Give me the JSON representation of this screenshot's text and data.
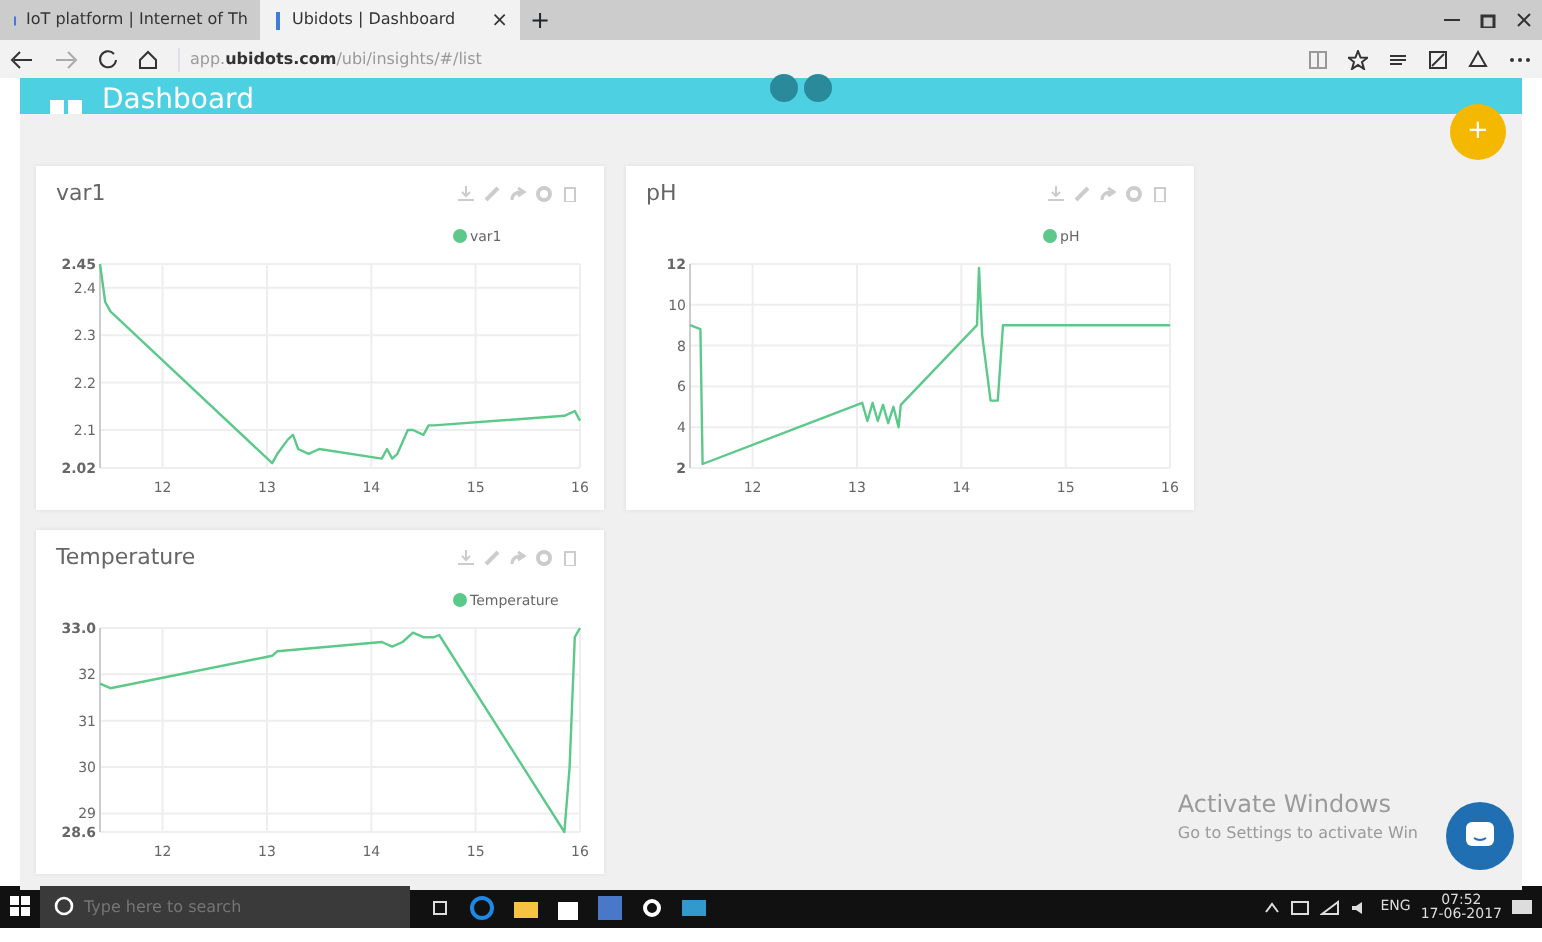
{
  "browser": {
    "tabs": [
      {
        "label": "IoT platform | Internet of Th",
        "selected": false
      },
      {
        "label": "Ubidots | Dashboard",
        "selected": true
      }
    ],
    "tab_close": "×",
    "new_tab": "+",
    "address": "app.**ubidots.com**/ubi/insights/#/list"
  },
  "header": {
    "title": "Dashboard",
    "fab": "+"
  },
  "widgets": [
    {
      "title": "var1",
      "chart_data": {
        "type": "line",
        "x": [
          11.4,
          11.45,
          11.5,
          13.05,
          13.1,
          13.2,
          13.25,
          13.3,
          13.4,
          13.5,
          14.1,
          14.15,
          14.2,
          14.25,
          14.35,
          14.4,
          14.5,
          14.55,
          14.6,
          15.85,
          15.95,
          16
        ],
        "series": [
          {
            "name": "var1",
            "color": "#5cc98a",
            "values": [
              2.45,
              2.37,
              2.35,
              2.03,
              2.05,
              2.08,
              2.09,
              2.06,
              2.05,
              2.06,
              2.04,
              2.06,
              2.04,
              2.05,
              2.1,
              2.1,
              2.09,
              2.11,
              2.11,
              2.13,
              2.14,
              2.12
            ]
          }
        ],
        "xlim": [
          11.4,
          16
        ],
        "ylim": [
          2.02,
          2.45
        ],
        "xticks": [
          12,
          13,
          14,
          15,
          16
        ],
        "yticks": [
          2.02,
          2.1,
          2.2,
          2.3,
          2.4,
          2.45
        ],
        "grid": true
      }
    },
    {
      "title": "pH",
      "chart_data": {
        "type": "line",
        "x": [
          11.4,
          11.5,
          11.52,
          13.05,
          13.1,
          13.15,
          13.2,
          13.25,
          13.3,
          13.35,
          13.4,
          13.42,
          14.15,
          14.17,
          14.2,
          14.28,
          14.35,
          14.4,
          16
        ],
        "series": [
          {
            "name": "pH",
            "color": "#5cc98a",
            "values": [
              9,
              8.8,
              2.2,
              5.2,
              4.3,
              5.2,
              4.3,
              5.1,
              4.2,
              5,
              4,
              5.1,
              9,
              11.8,
              8.5,
              5.3,
              5.3,
              9,
              9
            ]
          }
        ],
        "xlim": [
          11.4,
          16
        ],
        "ylim": [
          2,
          12
        ],
        "xticks": [
          12,
          13,
          14,
          15,
          16
        ],
        "yticks": [
          2,
          4,
          6,
          8,
          10,
          12
        ],
        "grid": true
      }
    },
    {
      "title": "Temperature",
      "chart_data": {
        "type": "line",
        "x": [
          11.4,
          11.5,
          13.05,
          13.1,
          14.1,
          14.2,
          14.3,
          14.4,
          14.5,
          14.6,
          14.65,
          15.85,
          15.9,
          15.95,
          16
        ],
        "series": [
          {
            "name": "Temperature",
            "color": "#5cc98a",
            "values": [
              31.8,
              31.7,
              32.4,
              32.5,
              32.7,
              32.6,
              32.7,
              32.9,
              32.8,
              32.8,
              32.85,
              28.6,
              30,
              32.8,
              33
            ]
          }
        ],
        "xlim": [
          11.4,
          16
        ],
        "ylim": [
          28.6,
          33
        ],
        "xticks": [
          12,
          13,
          14,
          15,
          16
        ],
        "yticks": [
          28.6,
          29,
          30,
          31,
          32,
          {
            "value": 33,
            "label": "33.0"
          }
        ],
        "grid": true
      }
    }
  ],
  "activation": {
    "title": "Activate Windows",
    "text": "Go to Settings to activate Win"
  },
  "taskbar": {
    "search_placeholder": "Type here to search",
    "language": "ENG",
    "time": "07:52",
    "date": "17-06-2017"
  }
}
